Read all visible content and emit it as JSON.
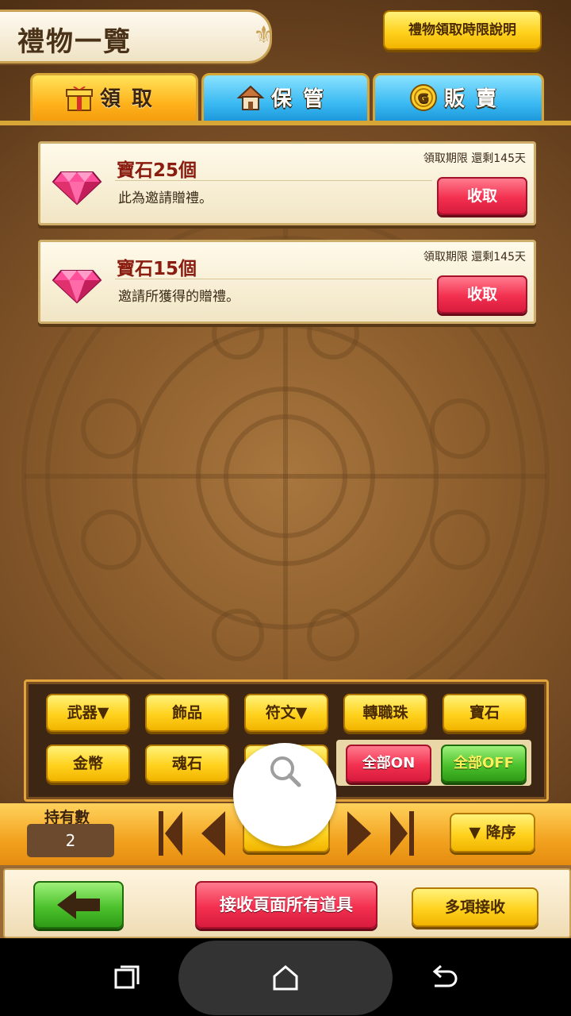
{
  "header": {
    "title": "禮物一覽",
    "limit_button": "禮物領取時限說明"
  },
  "tabs": [
    {
      "label": "領取",
      "icon": "gift-icon",
      "active": true
    },
    {
      "label": "保管",
      "icon": "house-icon",
      "active": false
    },
    {
      "label": "販賣",
      "icon": "coin-icon",
      "coin_letter": "G",
      "active": false
    }
  ],
  "gifts": [
    {
      "name": "寶石25個",
      "desc": "此為邀請贈禮。",
      "expiry": "領取期限 還剩145天",
      "button": "收取",
      "icon": "pink-gem-icon"
    },
    {
      "name": "寶石15個",
      "desc": "邀請所獲得的贈禮。",
      "expiry": "領取期限 還剩145天",
      "button": "收取",
      "icon": "pink-gem-icon"
    }
  ],
  "filters": {
    "row1": [
      "武器▼",
      "飾品",
      "符文▼",
      "轉職珠",
      "寶石"
    ],
    "row2": [
      "金幣",
      "魂石",
      ""
    ],
    "all_on": "全部ON",
    "all_off": "全部OFF"
  },
  "holdings": {
    "label": "持有數",
    "value": "2"
  },
  "sort_button": "▼ 降序",
  "actions": {
    "receive_all": "接收頁面所有道具",
    "multi_receive": "多項接收"
  },
  "colors": {
    "accent_yellow": "#ffd21e",
    "red_button": "#f3304f",
    "green_button": "#4cc22d",
    "tab_blue": "#39b9f2",
    "tab_orange": "#ffb21c"
  }
}
